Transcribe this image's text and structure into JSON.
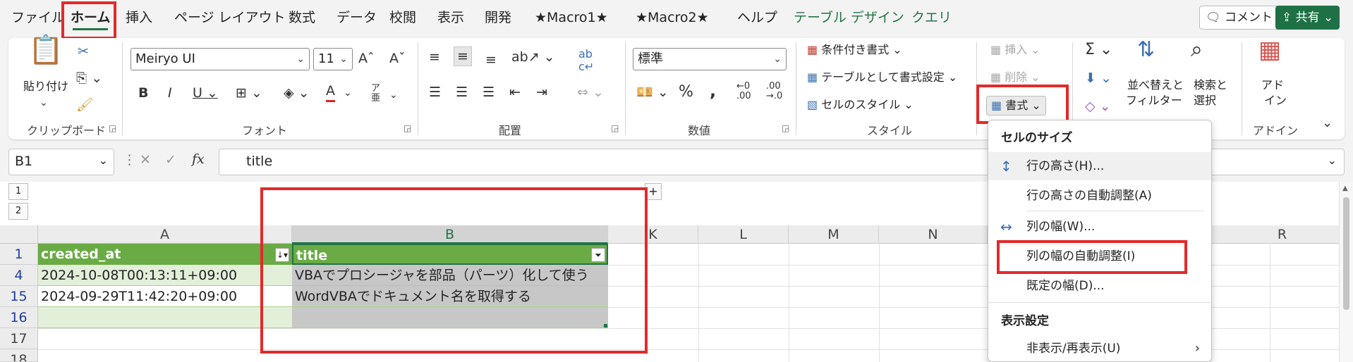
{
  "tabs": [
    {
      "label": "ファイル",
      "active": false
    },
    {
      "label": "ホーム",
      "active": true
    },
    {
      "label": "挿入",
      "active": false
    },
    {
      "label": "ページ レイアウト",
      "active": false
    },
    {
      "label": "数式",
      "active": false
    },
    {
      "label": "データ",
      "active": false
    },
    {
      "label": "校閲",
      "active": false
    },
    {
      "label": "表示",
      "active": false
    },
    {
      "label": "開発",
      "active": false
    },
    {
      "label": "★Macro1★",
      "active": false
    },
    {
      "label": "★Macro2★",
      "active": false
    },
    {
      "label": "ヘルプ",
      "active": false
    },
    {
      "label": "テーブル デザイン",
      "active": false
    },
    {
      "label": "クエリ",
      "active": false
    }
  ],
  "header_buttons": {
    "comment": "コメント",
    "share": "共有"
  },
  "ribbon": {
    "clipboard": {
      "label": "クリップボード",
      "paste": "貼り付け"
    },
    "font": {
      "label": "フォント",
      "name": "Meiryo UI",
      "size": "11"
    },
    "alignment": {
      "label": "配置"
    },
    "number": {
      "label": "数値",
      "format": "標準"
    },
    "styles": {
      "label": "スタイル",
      "conditional": "条件付き書式",
      "table": "テーブルとして書式設定",
      "cell_style": "セルのスタイル"
    },
    "cells": {
      "insert": "挿入",
      "delete": "削除",
      "format": "書式"
    },
    "editing": {
      "sort_filter_1": "並べ替えと",
      "sort_filter_2": "フィルター",
      "find_1": "検索と",
      "find_2": "選択"
    },
    "addins": {
      "label": "アドイン",
      "btn_1": "アド",
      "btn_2": "イン"
    }
  },
  "formula_bar": {
    "name_box": "B1",
    "fx": "fx",
    "value": "title"
  },
  "outline_levels": [
    "1",
    "2"
  ],
  "columns": [
    "A",
    "B",
    "K",
    "L",
    "M",
    "N",
    "R"
  ],
  "rows": [
    {
      "num": "1",
      "a": "created_at",
      "b": "title"
    },
    {
      "num": "4",
      "a": "2024-10-08T00:13:11+09:00",
      "b": "VBAでプロシージャを部品（パーツ）化して使う"
    },
    {
      "num": "15",
      "a": "2024-09-29T11:42:20+09:00",
      "b": "WordVBAでドキュメント名を取得する"
    },
    {
      "num": "16",
      "a": "",
      "b": ""
    },
    {
      "num": "17",
      "a": "",
      "b": ""
    },
    {
      "num": "18",
      "a": "",
      "b": ""
    }
  ],
  "format_menu": {
    "section1": "セルのサイズ",
    "items1": [
      "行の高さ(H)...",
      "行の高さの自動調整(A)",
      "列の幅(W)...",
      "列の幅の自動調整(I)",
      "既定の幅(D)..."
    ],
    "section2": "表示設定",
    "items2": [
      "非表示/再表示(U)"
    ]
  },
  "colors": {
    "accent": "#217346",
    "highlight_box": "#e22a2a",
    "header_fill": "#6aab46"
  }
}
